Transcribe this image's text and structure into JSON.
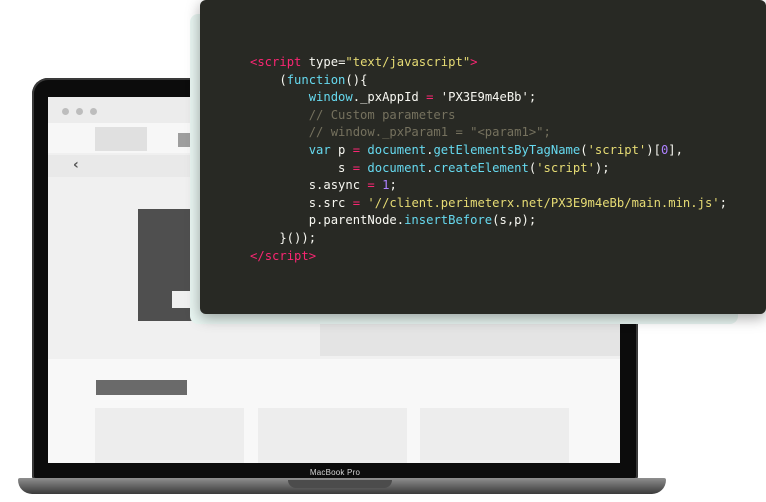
{
  "laptop": {
    "brand_label": "MacBook Pro"
  },
  "code": {
    "line1": {
      "open": "<",
      "tag": "script",
      "sp": " ",
      "attr": "type",
      "eq": "=",
      "val": "\"text/javascript\"",
      "close": ">"
    },
    "line2": {
      "indent": "    (",
      "kw": "function",
      "rest": "(){"
    },
    "line3": {
      "indent": "        ",
      "obj": "window",
      "prop": "._pxAppId ",
      "op": "=",
      "sp": " ",
      "str": "'PX3E9m4eBb'",
      "end": ";"
    },
    "line4": {
      "text": "        // Custom parameters"
    },
    "line5": {
      "text": "        // window._pxParam1 = \"<param1>\";"
    },
    "line6": {
      "indent": "        ",
      "kw": "var",
      "a": " p ",
      "op": "=",
      "sp": " ",
      "obj": "document",
      "dot": ".",
      "fn": "getElementsByTagName",
      "p1": "(",
      "str": "'script'",
      "p2": ")[",
      "num": "0",
      "p3": "],"
    },
    "line7": {
      "indent": "            s ",
      "op": "=",
      "sp": " ",
      "obj": "document",
      "dot": ".",
      "fn": "createElement",
      "p1": "(",
      "str": "'script'",
      "p2": ");"
    },
    "line8": {
      "indent": "        s.async ",
      "op": "=",
      "sp": " ",
      "num": "1",
      "end": ";"
    },
    "line9": {
      "indent": "        s.src ",
      "op": "=",
      "sp": " ",
      "str": "'//client.perimeterx.net/PX3E9m4eBb/main.min.js'",
      "end": ";"
    },
    "line10": {
      "indent": "        p.parentNode.",
      "fn": "insertBefore",
      "rest": "(s,p);"
    },
    "line11": {
      "text": "    }());"
    },
    "line12": {
      "open": "</",
      "tag": "script",
      "close": ">"
    }
  }
}
